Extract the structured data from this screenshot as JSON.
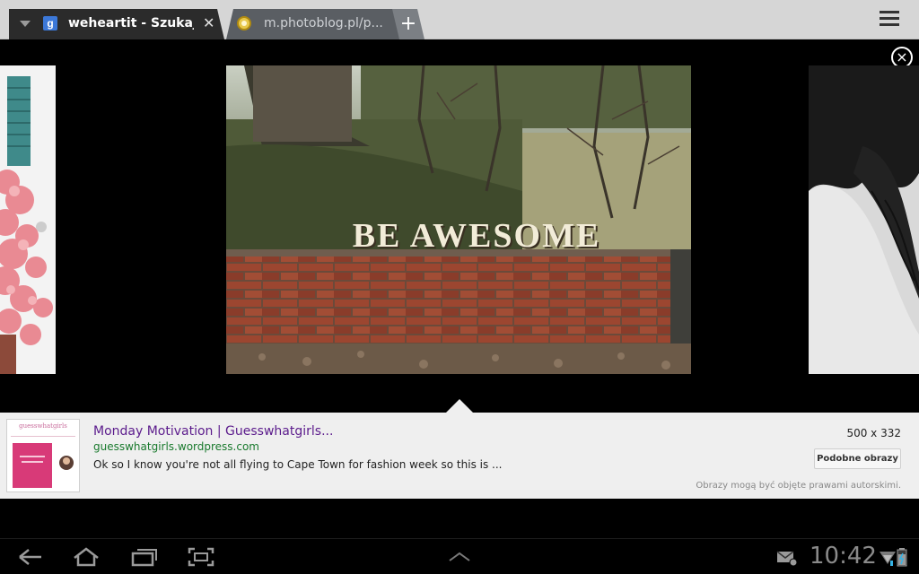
{
  "tabs": [
    {
      "title": "weheartit - Szukaj...",
      "icon": "google-icon",
      "active": true
    },
    {
      "title": "m.photoblog.pl/p...",
      "icon": "photoblog-icon",
      "active": false
    }
  ],
  "icons": {
    "google": "g",
    "close": "✕",
    "new_tab": "+",
    "viewer_close": "×"
  },
  "image_caption": "BE AWESOME",
  "result": {
    "title": "Monday Motivation | Guesswhatgirls...",
    "url": "guesswhatgirls.wordpress.com",
    "snippet": "Ok so I know you're not all flying to Cape Town for fashion week so this is ...",
    "size": "500 x 332",
    "similar_label": "Podobne obrazy",
    "copyright": "Obrazy mogą być objęte prawami autorskimi.",
    "thumb_logo": "guesswhatgirls"
  },
  "system": {
    "time": "10:42"
  },
  "colors": {
    "title_link": "#5b1b8c",
    "url_green": "#18792c",
    "tab_active": "#2b2b2b",
    "tabstrip": "#d6d6d6"
  }
}
